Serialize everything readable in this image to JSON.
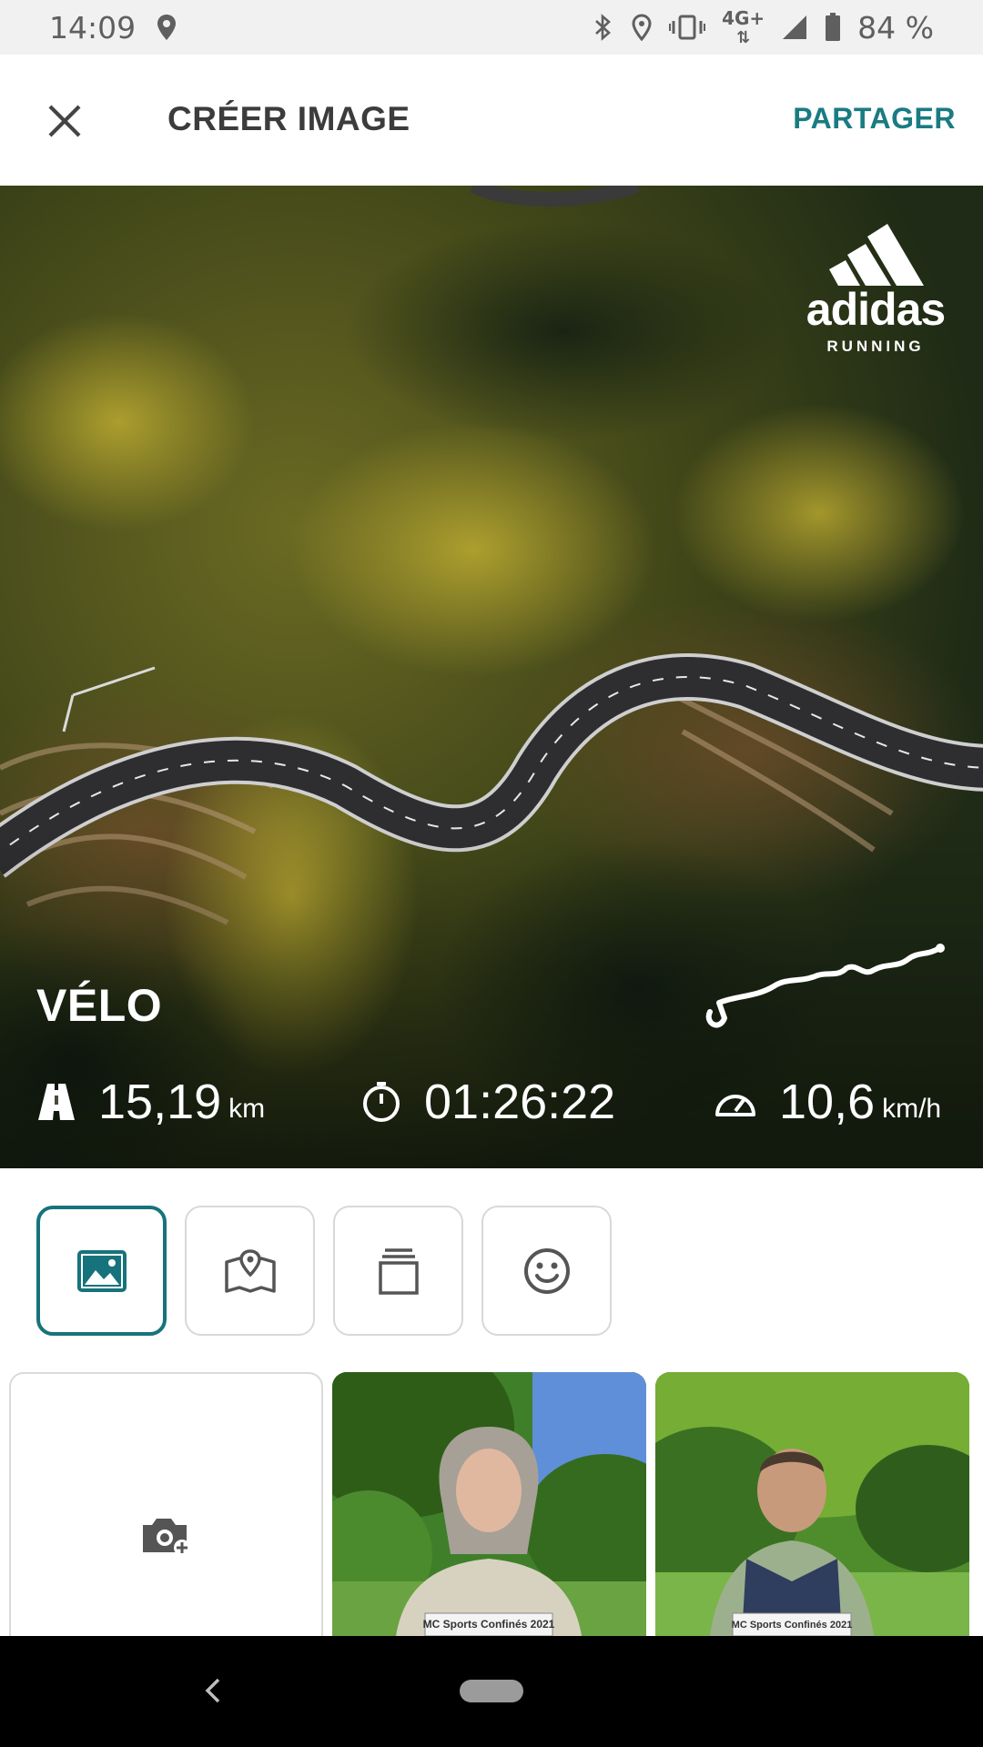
{
  "status_bar": {
    "time": "14:09",
    "network": "4G+",
    "battery": "84 %",
    "icons": [
      "location-icon",
      "bluetooth-icon",
      "location-icon",
      "vibrate-icon",
      "signal-icon",
      "battery-icon"
    ]
  },
  "app_bar": {
    "title": "CRÉER IMAGE",
    "share_label": "PARTAGER",
    "close_icon": "close-icon",
    "accent_color": "#1a7b83"
  },
  "preview": {
    "brand": "adidas",
    "brand_sub": "RUNNING",
    "sport": "VÉLO",
    "distance": {
      "value": "15,19",
      "unit": "km",
      "icon": "road-icon"
    },
    "duration": {
      "value": "01:26:22",
      "icon": "stopwatch-icon"
    },
    "speed": {
      "value": "10,6",
      "unit": "km/h",
      "icon": "speedometer-icon"
    }
  },
  "tools": [
    {
      "icon": "image-icon",
      "active": true
    },
    {
      "icon": "map-icon",
      "active": false
    },
    {
      "icon": "layers-icon",
      "active": false
    },
    {
      "icon": "smiley-icon",
      "active": false
    }
  ],
  "gallery": {
    "add_icon": "camera-add-icon",
    "photo_1_caption": "MC Sports Confinés 2021",
    "photo_2_caption": "MC Sports Confinés 2021"
  },
  "nav_bar": {
    "icons": [
      "back-icon",
      "home-pill"
    ]
  }
}
